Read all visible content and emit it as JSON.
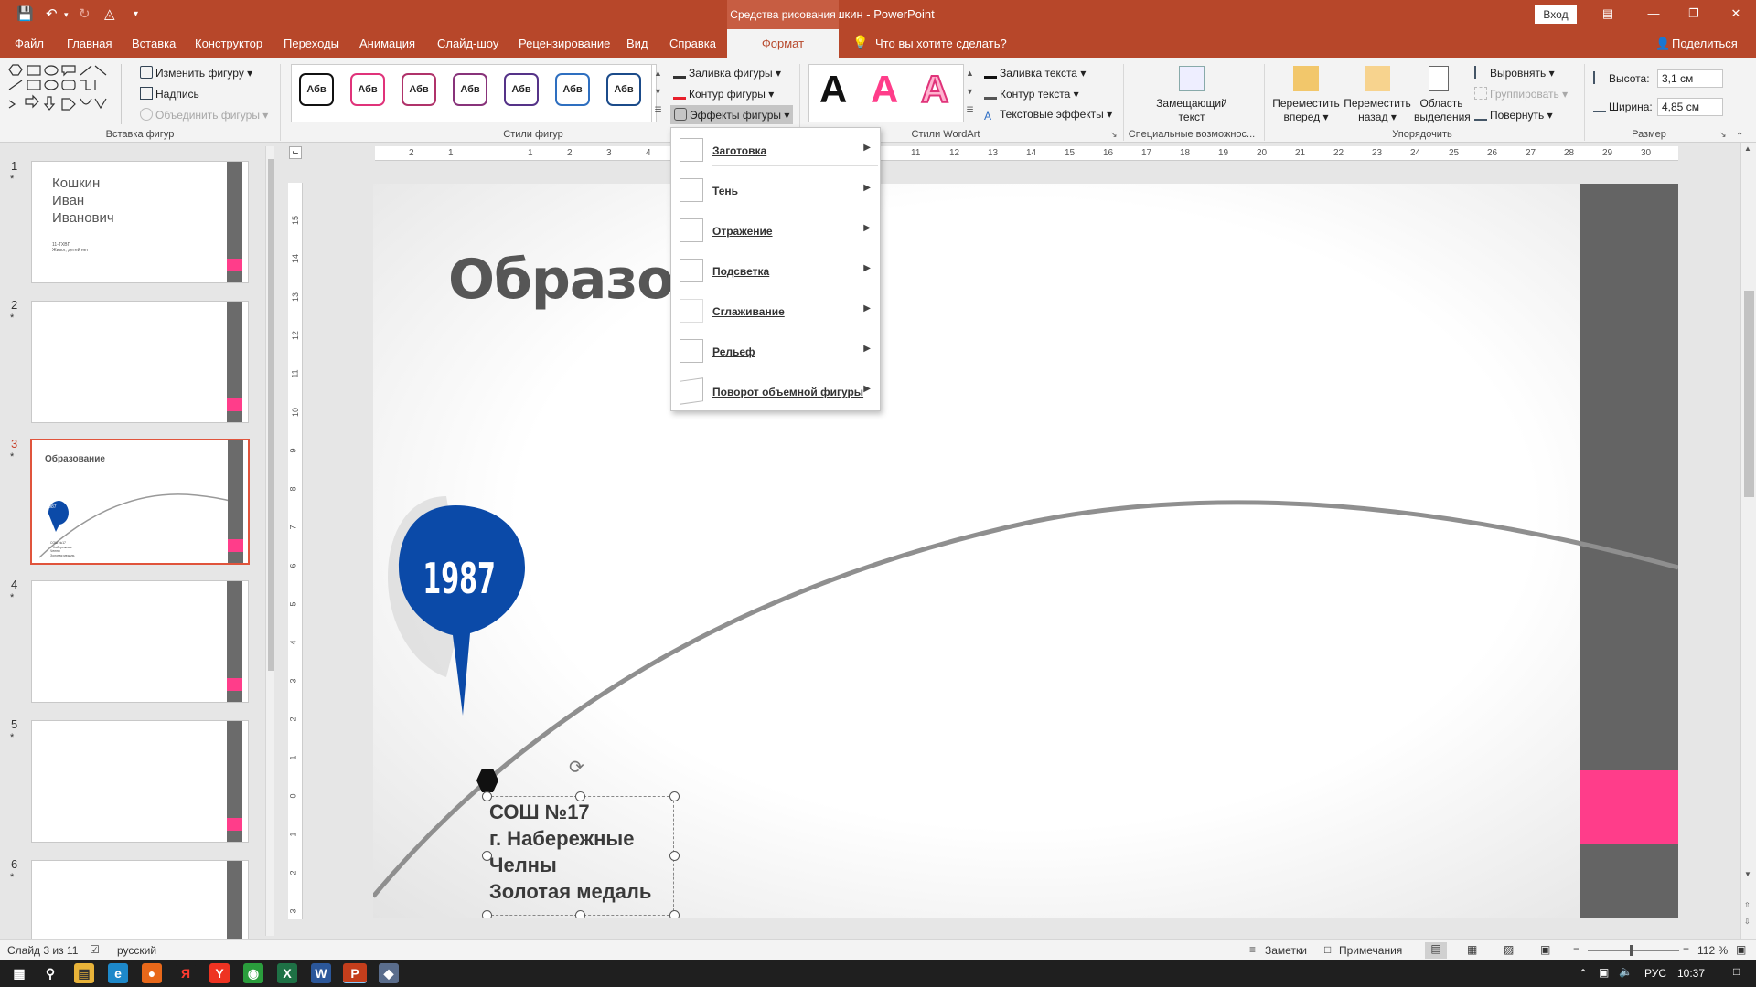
{
  "title_bar": {
    "doc_title": "Кошкин - PowerPoint",
    "tools_tab_title": "Средства рисования",
    "signin": "Вход"
  },
  "tabs": [
    "Файл",
    "Главная",
    "Вставка",
    "Конструктор",
    "Переходы",
    "Анимация",
    "Слайд-шоу",
    "Рецензирование",
    "Вид",
    "Справка",
    "Формат"
  ],
  "tell_me": "Что вы хотите сделать?",
  "share": "Поделиться",
  "ribbon": {
    "insert_shapes": {
      "edit_shape": "Изменить фигуру",
      "textbox": "Надпись",
      "merge_shapes": "Объединить фигуры",
      "label": "Вставка фигур"
    },
    "shape_styles": {
      "style_text": "Абв",
      "fill": "Заливка фигуры",
      "outline": "Контур фигуры",
      "effects": "Эффекты фигуры",
      "label": "Стили фигур"
    },
    "wordart": {
      "letter": "A",
      "text_fill": "Заливка текста",
      "text_outline": "Контур текста",
      "text_effects": "Текстовые эффекты",
      "label": "Стили WordArt"
    },
    "accessibility": {
      "alt_text_line1": "Замещающий",
      "alt_text_line2": "текст",
      "label": "Специальные возможнос..."
    },
    "arrange": {
      "bring_forward_1": "Переместить",
      "bring_forward_2": "вперед",
      "send_backward_1": "Переместить",
      "send_backward_2": "назад",
      "selection_pane_1": "Область",
      "selection_pane_2": "выделения",
      "align": "Выровнять",
      "group": "Группировать",
      "rotate": "Повернуть",
      "label": "Упорядочить"
    },
    "size": {
      "height_label": "Высота:",
      "height_value": "3,1 см",
      "width_label": "Ширина:",
      "width_value": "4,85 см",
      "label": "Размер"
    }
  },
  "effects_menu": [
    {
      "label": "Заготовка"
    },
    {
      "label": "Тень"
    },
    {
      "label": "Отражение"
    },
    {
      "label": "Подсветка"
    },
    {
      "label": "Сглаживание"
    },
    {
      "label": "Рельеф"
    },
    {
      "label": "Поворот объемной фигуры"
    }
  ],
  "thumbnails": [
    {
      "num": "1",
      "title_lines": [
        "Кошкин",
        "Иван",
        "Иванович"
      ],
      "small_lines": [
        "11-ТХВП",
        "Живот, детей нет"
      ]
    },
    {
      "num": "2"
    },
    {
      "num": "3",
      "title": "Образование",
      "year": "1987",
      "small_lines": [
        "СОШ №17",
        "г. Набережные",
        "Челны",
        "Золотая медаль"
      ]
    },
    {
      "num": "4"
    },
    {
      "num": "5"
    },
    {
      "num": "6"
    }
  ],
  "ruler_numbers": [
    "2",
    "1",
    "1",
    "2",
    "3",
    "4",
    "11",
    "12",
    "13",
    "14",
    "15",
    "16",
    "17",
    "18",
    "19",
    "20",
    "21",
    "22",
    "23",
    "24",
    "25",
    "26",
    "27",
    "28",
    "29",
    "30"
  ],
  "vruler_numbers": [
    "15",
    "14",
    "13",
    "12",
    "11",
    "10",
    "9",
    "8",
    "7",
    "6",
    "5",
    "4",
    "3",
    "2",
    "1",
    "0",
    "1",
    "2",
    "3"
  ],
  "slide": {
    "title": "Образова",
    "year": "1987",
    "textbox_lines": [
      "СОШ №17",
      "г. Набережные",
      "Челны",
      "Золотая медаль"
    ]
  },
  "status_bar": {
    "slide_count": "Слайд 3 из 11",
    "language": "русский",
    "notes": "Заметки",
    "comments": "Примечания",
    "zoom": "112 %"
  },
  "taskbar": {
    "lang": "РУС",
    "time": "10:37"
  },
  "colors": {
    "accent": "#b7472a",
    "slide_bar": "#646464",
    "pink": "#ff3d8a",
    "bubble": "#0b4aa8"
  }
}
